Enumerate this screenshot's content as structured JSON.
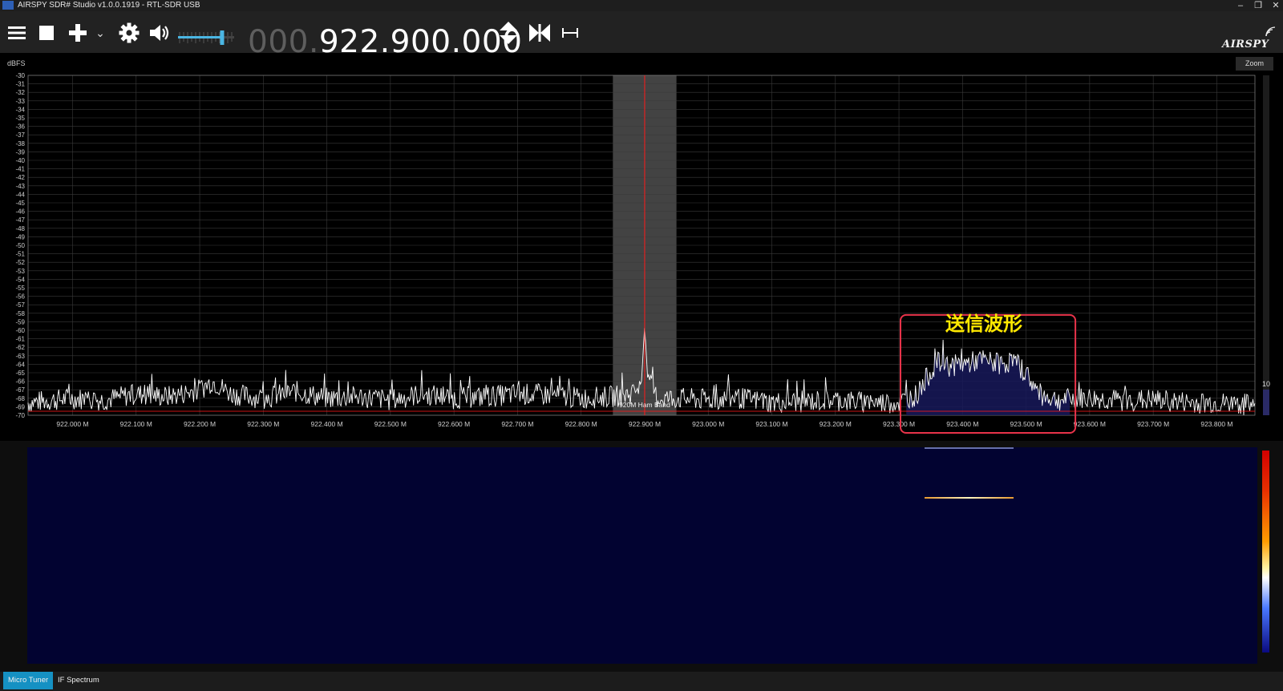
{
  "window": {
    "title": "AIRSPY SDR# Studio v1.0.0.1919 - RTL-SDR USB",
    "minimize": "–",
    "restore": "❐",
    "close": "✕"
  },
  "toolbar": {
    "menu_icon": "hamburger-menu-icon",
    "stop_icon": "stop-icon",
    "add_icon": "plus-icon",
    "add_dropdown": "⌄",
    "settings_icon": "gear-icon",
    "volume_icon": "speaker-icon",
    "volume_level": 0.82,
    "frequency_dim": "000.",
    "frequency": "922.900.000",
    "step_icon": "up-down-arrow-icon",
    "center_icon": "snap-center-icon",
    "bandwidth_icon": "span-icon",
    "logo": "AIRSPY"
  },
  "spectrum": {
    "unit": "dBFS",
    "zoom_label": "Zoom",
    "side_value": "10",
    "band_label": "920M Ham Band",
    "annotation": "送信波形",
    "colors": {
      "trace": "#ffffff",
      "grid": "#3a3a3a",
      "tune_line": "#ff1a1a",
      "filter": "#5a5a5a",
      "highlight_box": "#e8334a",
      "annotation": "#ffe800"
    }
  },
  "chart_data": {
    "type": "line",
    "xlabel": "",
    "ylabel": "dBFS",
    "ylim": [
      -70,
      -30
    ],
    "xlim": [
      921.93,
      923.86
    ],
    "y_ticks": [
      -30,
      -31,
      -32,
      -33,
      -34,
      -35,
      -36,
      -37,
      -38,
      -39,
      -40,
      -41,
      -42,
      -43,
      -44,
      -45,
      -46,
      -47,
      -48,
      -49,
      -50,
      -51,
      -52,
      -53,
      -54,
      -55,
      -56,
      -57,
      -58,
      -59,
      -60,
      -61,
      -62,
      -63,
      -64,
      -65,
      -66,
      -67,
      -68,
      -69,
      -70
    ],
    "x_ticks": [
      "922.000 M",
      "922.100 M",
      "922.200 M",
      "922.300 M",
      "922.400 M",
      "922.500 M",
      "922.600 M",
      "922.700 M",
      "922.800 M",
      "922.900 M",
      "923.000 M",
      "923.100 M",
      "923.200 M",
      "923.300 M",
      "923.400 M",
      "923.500 M",
      "923.600 M",
      "923.700 M",
      "923.800 M"
    ],
    "x_tick_values": [
      922.0,
      922.1,
      922.2,
      922.3,
      922.4,
      922.5,
      922.6,
      922.7,
      922.8,
      922.9,
      923.0,
      923.1,
      923.2,
      923.3,
      923.4,
      923.5,
      923.6,
      923.7,
      923.8
    ],
    "series": [
      {
        "x": [
          921.93,
          922.0,
          922.05,
          922.1,
          922.15,
          922.2,
          922.22,
          922.25,
          922.3,
          922.35,
          922.4,
          922.45,
          922.5,
          922.55,
          922.6,
          922.65,
          922.7,
          922.75,
          922.8,
          922.85,
          922.88,
          922.895,
          922.9,
          922.905,
          922.92,
          922.95,
          923.0,
          923.05,
          923.1,
          923.15,
          923.2,
          923.25,
          923.3,
          923.33,
          923.34,
          923.36,
          923.38,
          923.4,
          923.43,
          923.46,
          923.48,
          923.5,
          923.52,
          923.55,
          923.6,
          923.65,
          923.7,
          923.75,
          923.8,
          923.86
        ],
        "y": [
          -68.5,
          -68,
          -68.2,
          -67.5,
          -67.8,
          -67,
          -66,
          -67.5,
          -68,
          -67.2,
          -68,
          -67.8,
          -68.2,
          -67.5,
          -68,
          -67.8,
          -67.5,
          -67.6,
          -68,
          -67.8,
          -67.5,
          -66,
          -59.5,
          -66,
          -68,
          -68,
          -68.2,
          -68,
          -68.5,
          -68.4,
          -68.2,
          -68.5,
          -68.5,
          -67.5,
          -66,
          -63.8,
          -64.2,
          -64,
          -63.5,
          -64,
          -63.6,
          -65,
          -67.5,
          -68.2,
          -68,
          -68.3,
          -68.2,
          -68.5,
          -68.6,
          -68.8
        ]
      }
    ],
    "center_frequency": 922.9,
    "filter_bandwidth": [
      922.85,
      922.95
    ],
    "highlight_range": [
      923.31,
      923.57
    ]
  },
  "waterfall": {
    "signal_trace_range": [
      923.34,
      923.48
    ]
  },
  "status": {
    "tabs": [
      {
        "label": "Micro Tuner"
      },
      {
        "label": "IF Spectrum"
      }
    ]
  }
}
